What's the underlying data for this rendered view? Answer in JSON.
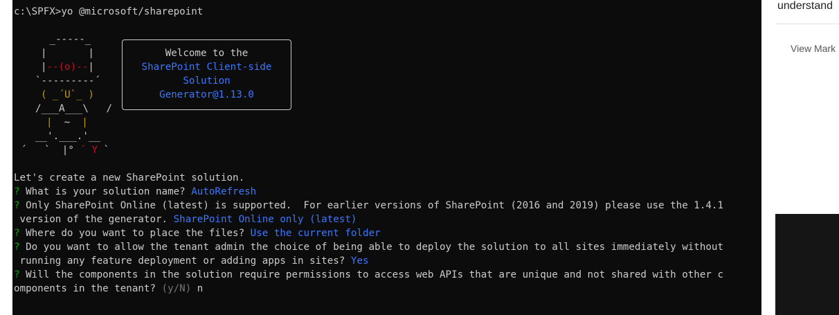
{
  "terminal": {
    "command_line": "c:\\SPFX>yo @microsoft/sharepoint",
    "welcome": {
      "line1": "Welcome to the",
      "line2": "SharePoint Client-side",
      "line3": "Solution",
      "line4": "Generator@1.13.0"
    },
    "art": {
      "l1": " _-----_",
      "l2a": "|       |",
      "l3a": "|",
      "l3b": "--(o)--",
      "l3c": "|",
      "l4": "`---------´",
      "l5": "( _´U`_ )",
      "l6": "/___A___\\   /",
      "l7a": "|",
      "l7b": "~",
      "l7c": "|",
      "l8": "__'.___.'__",
      "l9a": "´   `  |° ",
      "l9b": "´ Y",
      "l9c": " `"
    },
    "intro": "Let's create a new SharePoint solution.",
    "prompt_marker": "?",
    "questions": [
      {
        "q": " What is your solution name? ",
        "a": "AutoRefresh"
      },
      {
        "q": " Only SharePoint Online (latest) is supported.  For earlier versions of SharePoint (2016 and 2019) please use the 1.4.1",
        "q2": " version of the generator. ",
        "a": "SharePoint Online only (latest)"
      },
      {
        "q": " Where do you want to place the files? ",
        "a": "Use the current folder"
      },
      {
        "q": " Do you want to allow the tenant admin the choice of being able to deploy the solution to all sites immediately without",
        "q2": " running any feature deployment or adding apps in sites? ",
        "a": "Yes"
      },
      {
        "q": " Will the components in the solution require permissions to access web APIs that are unique and not shared with other c",
        "q2": "omponents in the tenant? ",
        "hint": "(y/N)",
        "a": " n"
      }
    ]
  },
  "side_panel": {
    "title": "understand",
    "link": "View Mark"
  }
}
